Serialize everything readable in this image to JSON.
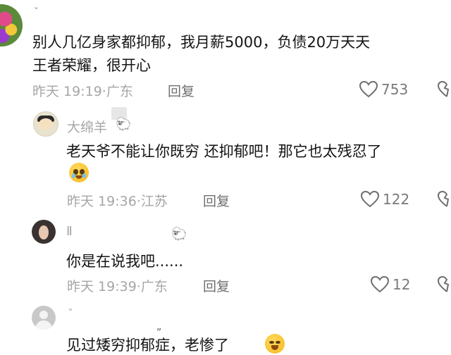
{
  "comments": [
    {
      "username": "",
      "text_line1": "别人几亿身家都抑郁，我月薪5000，负债20万天天",
      "text_line2": "王者荣耀，很开心",
      "time": "昨天 19:19",
      "location": "广东",
      "reply_label": "回复",
      "likes": "753"
    },
    {
      "username": "大绵羊",
      "text": "老天爷不能让你既穷 还抑郁吧！那它也太残忍了",
      "time": "昨天 19:36",
      "location": "江苏",
      "reply_label": "回复",
      "likes": "122"
    },
    {
      "username": "",
      "text": "你是在说我吧......",
      "time": "昨天 19:39",
      "location": "广东",
      "reply_label": "回复",
      "likes": "12"
    },
    {
      "username": "",
      "text": "见过矮穷抑郁症，老惨了"
    }
  ],
  "icons": {
    "like": "heart-outline-icon",
    "dislike": "broken-heart-icon",
    "badge": "sheep-emoji",
    "reaction": "pleading-face-emoji"
  },
  "colors": {
    "text": "#141414",
    "muted": "#a6a6a6",
    "reply": "#6f6f6f"
  }
}
